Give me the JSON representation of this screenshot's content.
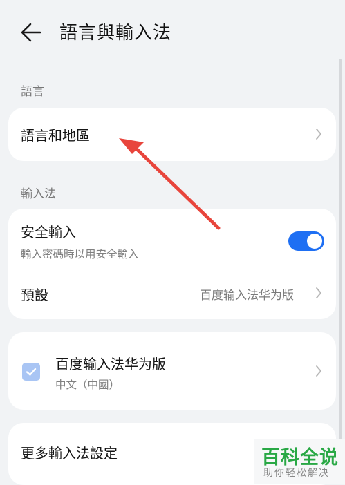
{
  "header": {
    "title": "語言與輸入法",
    "back_icon": "arrow-left-icon"
  },
  "sections": {
    "language": {
      "label": "語言"
    },
    "input_method": {
      "label": "輸入法"
    }
  },
  "language_card": {
    "item": {
      "title": "語言和地區",
      "icon": "chevron-right-icon"
    }
  },
  "input_card": {
    "secure_input": {
      "title": "安全輸入",
      "subtitle": "輸入密碼時以用安全輸入",
      "enabled": true
    },
    "default": {
      "title": "預設",
      "value": "百度输入法华为版",
      "icon": "chevron-right-icon"
    }
  },
  "ime_card": {
    "checked": true,
    "title": "百度输入法华为版",
    "subtitle": "中文（中國）",
    "icon": "chevron-right-icon"
  },
  "more_card": {
    "title": "更多輸入法設定"
  },
  "annotation": {
    "color": "#e8453c",
    "icon": "red-arrow-annotation"
  },
  "watermark": {
    "title": "百科全说",
    "subtitle": "助你轻松解决",
    "color": "#29a845"
  },
  "colors": {
    "accent": "#1e6ff3",
    "background": "#f1f3f5",
    "card": "#ffffff"
  }
}
